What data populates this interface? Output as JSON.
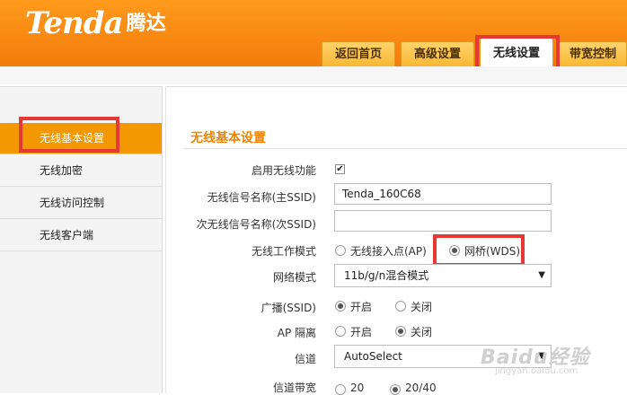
{
  "brand": {
    "logo": "Tenda",
    "logo_cn": "腾达"
  },
  "tabs": [
    {
      "label": "返回首页"
    },
    {
      "label": "高级设置"
    },
    {
      "label": "无线设置"
    },
    {
      "label": "带宽控制"
    }
  ],
  "sidebar": {
    "items": [
      {
        "label": "无线基本设置"
      },
      {
        "label": "无线加密"
      },
      {
        "label": "无线访问控制"
      },
      {
        "label": "无线客户端"
      }
    ]
  },
  "main": {
    "title": "无线基本设置",
    "enable_wireless": {
      "label": "启用无线功能",
      "checked": true,
      "mark": "✔"
    },
    "ssid": {
      "label": "无线信号名称(主SSID)",
      "value": "Tenda_160C68"
    },
    "ssid2": {
      "label": "次无线信号名称(次SSID)",
      "value": ""
    },
    "mode": {
      "label": "无线工作模式",
      "opt_ap": "无线接入点(AP)",
      "opt_wds": "网桥(WDS)",
      "selected": "网桥(WDS)"
    },
    "net_mode": {
      "label": "网络模式",
      "value": "11b/g/n混合模式",
      "caret": "▼"
    },
    "broadcast": {
      "label": "广播(SSID)",
      "on": "开启",
      "off": "关闭",
      "selected": "开启"
    },
    "ap_isolation": {
      "label": "AP 隔离",
      "on": "开启",
      "off": "关闭",
      "selected": "关闭"
    },
    "channel": {
      "label": "信道",
      "value": "AutoSelect",
      "caret": "▼"
    },
    "bandwidth": {
      "label": "信道带宽",
      "opt1": "20",
      "opt2": "20/40",
      "selected": "20/40"
    }
  },
  "watermark": {
    "text": "Baidu经验",
    "sub": "jingyan.baidu.com"
  }
}
